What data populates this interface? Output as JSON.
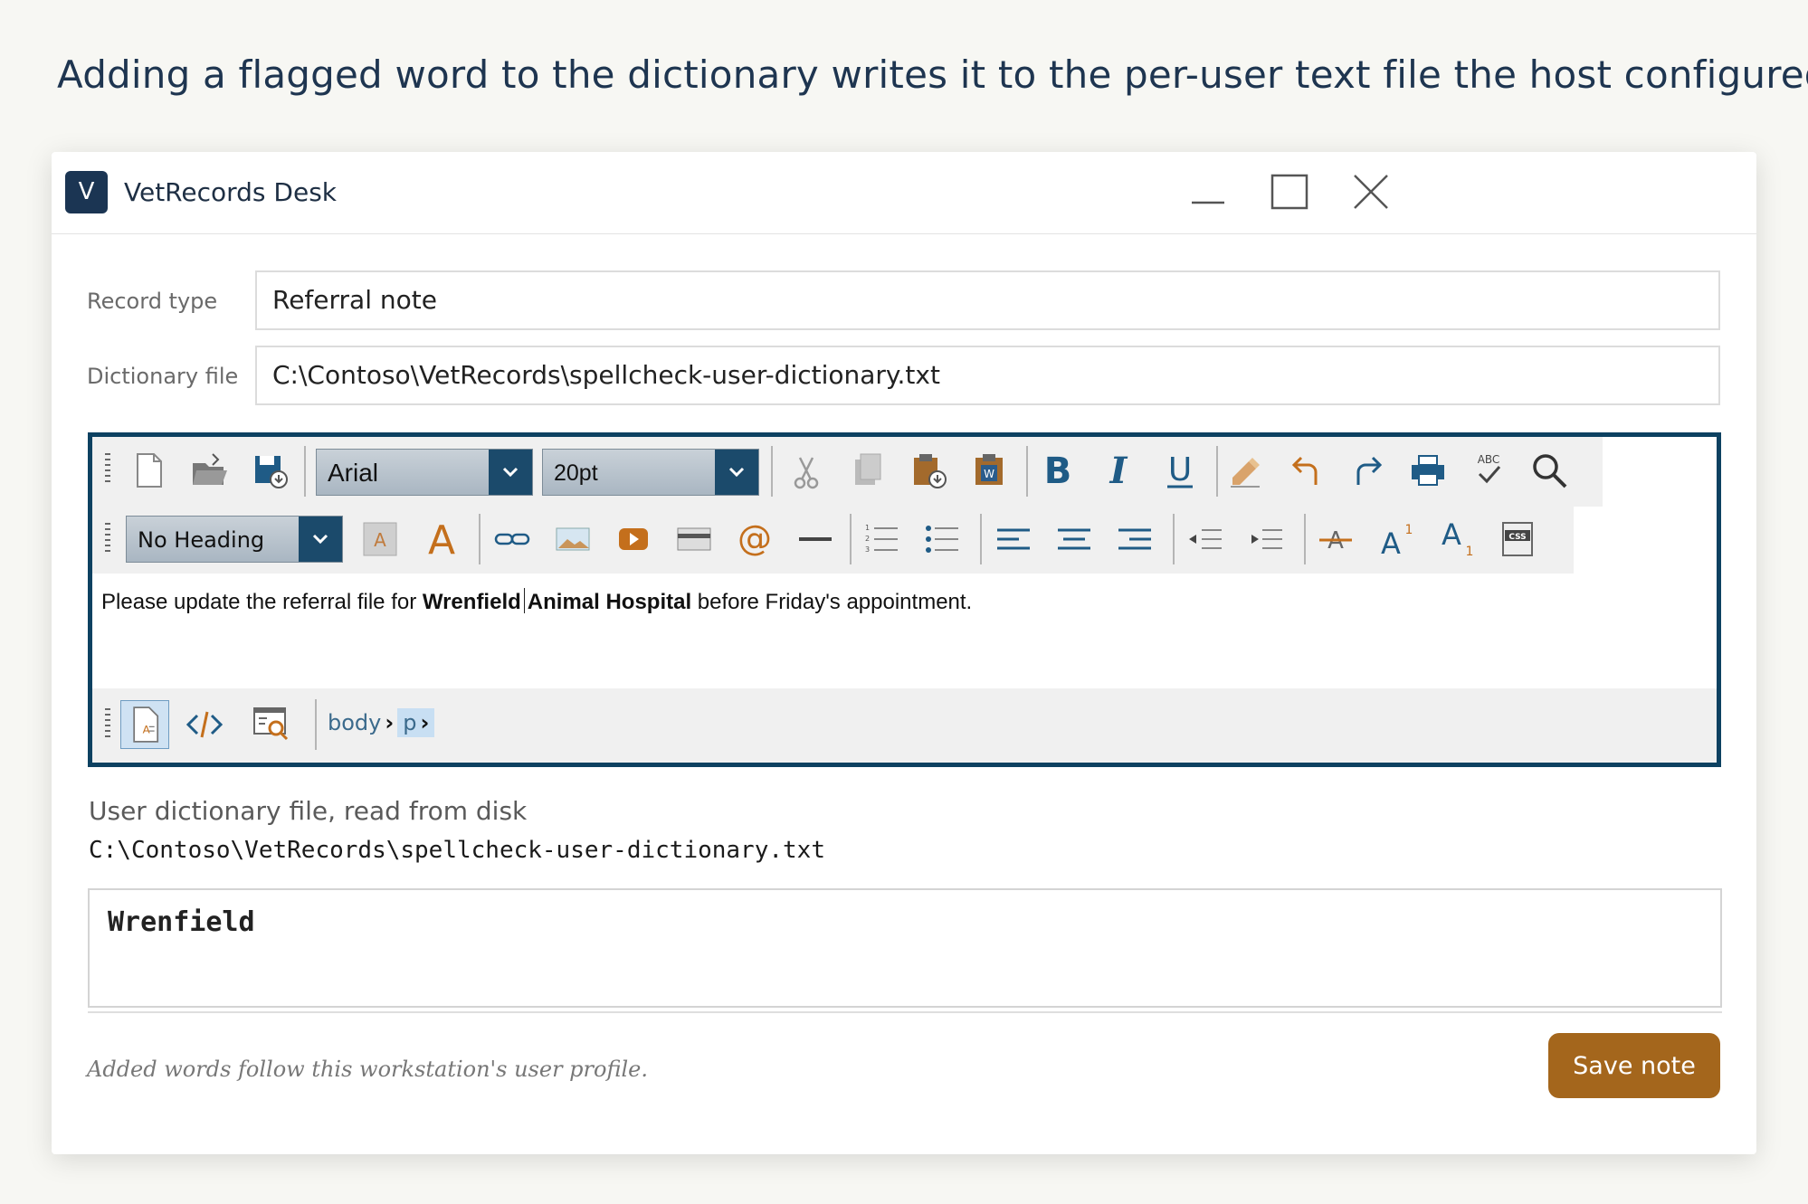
{
  "headline": "Adding a flagged word to the dictionary writes it to the per-user text file the host configured.",
  "window": {
    "logo_letter": "V",
    "title": "VetRecords Desk"
  },
  "form": {
    "record_type_label": "Record type",
    "record_type_value": "Referral note",
    "dictionary_file_label": "Dictionary file",
    "dictionary_file_value": "C:\\Contoso\\VetRecords\\spellcheck-user-dictionary.txt"
  },
  "editor": {
    "font_name": "Arial",
    "font_size": "20pt",
    "heading_style": "No Heading",
    "content": {
      "before": "Please update the referral file for ",
      "bold1": "Wrenfield",
      "bold2": "Animal Hospital",
      "after": " before Friday's appointment."
    },
    "breadcrumb": [
      "body",
      "p"
    ]
  },
  "dictionary": {
    "title": "User dictionary file, read from disk",
    "path": "C:\\Contoso\\VetRecords\\spellcheck-user-dictionary.txt",
    "contents": "Wrenfield"
  },
  "footer": {
    "note": "Added words follow this workstation's user profile.",
    "save_label": "Save note"
  },
  "colors": {
    "accent": "#a4661c",
    "editor_border": "#0d4161",
    "logo_bg": "#1b3553"
  }
}
